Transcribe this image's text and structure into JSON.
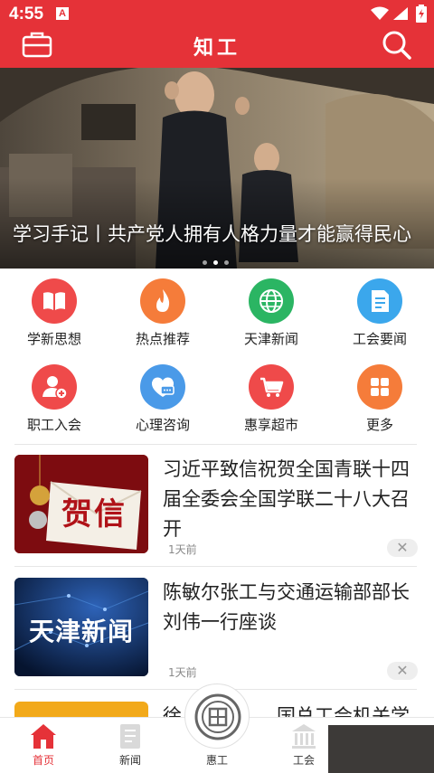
{
  "status_bar": {
    "time": "4:55",
    "notification_glyph": "A",
    "icons": [
      "wifi-icon",
      "signal-icon",
      "battery-icon"
    ]
  },
  "header": {
    "title": "知工",
    "left_icon": "briefcase-icon",
    "right_icon": "search-icon",
    "background": "#e53238"
  },
  "banner": {
    "caption": "学习手记丨共产党人拥有人格力量才能赢得民心",
    "slide_count": 3,
    "active_slide": 2
  },
  "quick_links": [
    {
      "label": "学新思想",
      "icon": "book-icon",
      "color": "#ef4a4a"
    },
    {
      "label": "热点推荐",
      "icon": "fire-icon",
      "color": "#f57c3a"
    },
    {
      "label": "天津新闻",
      "icon": "globe-icon",
      "color": "#2bb563"
    },
    {
      "label": "工会要闻",
      "icon": "document-icon",
      "color": "#3ba7ec"
    },
    {
      "label": "职工入会",
      "icon": "add-user-icon",
      "color": "#ef4a4a"
    },
    {
      "label": "心理咨询",
      "icon": "heart-chat-icon",
      "color": "#4a9ae8"
    },
    {
      "label": "惠享超市",
      "icon": "cart-icon",
      "color": "#ef4a4a"
    },
    {
      "label": "更多",
      "icon": "grid-icon",
      "color": "#f57c3a"
    }
  ],
  "news": [
    {
      "title": "习近平致信祝贺全国青联十四届全委会全国学联二十八大召开",
      "time": "1天前",
      "thumb_text": "贺信"
    },
    {
      "title": "陈敏尔张工与交通运输部部长刘伟一行座谈",
      "time": "1天前",
      "thumb_text": "天津新闻"
    }
  ],
  "partial_news": {
    "title": "徐　　　　　国总工会机关学"
  },
  "bottom_nav": [
    {
      "label": "首页",
      "icon": "home-icon",
      "active": true
    },
    {
      "label": "新闻",
      "icon": "news-icon",
      "active": false
    },
    {
      "label": "惠工",
      "icon": "union-logo-icon",
      "active": false
    },
    {
      "label": "工会",
      "icon": "building-icon",
      "active": false
    },
    {
      "label": "",
      "icon": "",
      "active": false
    }
  ],
  "close_symbol": "✕"
}
